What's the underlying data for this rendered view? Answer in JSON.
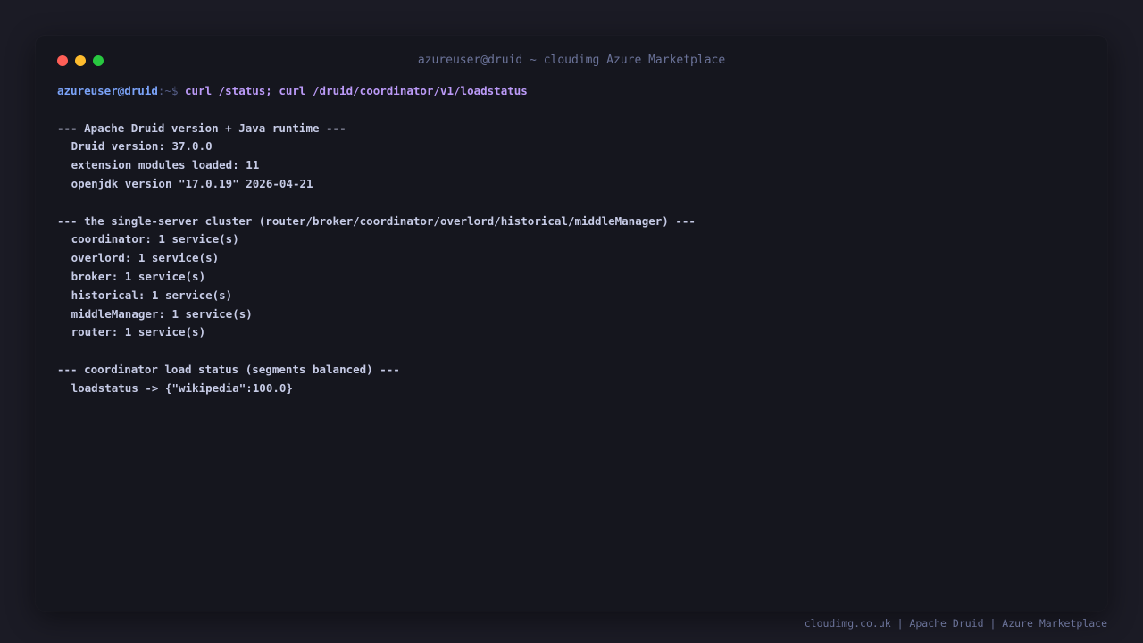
{
  "window": {
    "title": "azureuser@druid ~ cloudimg Azure Marketplace",
    "controls": {
      "close_color": "#ff5f57",
      "minimize_color": "#febc2e",
      "maximize_color": "#28c840"
    }
  },
  "prompt": {
    "user_host": "azureuser@druid",
    "separator": ":~$ ",
    "command": "curl /status; curl /druid/coordinator/v1/loadstatus"
  },
  "sections": {
    "version": {
      "header": "--- Apache Druid version + Java runtime ---",
      "lines": [
        "Druid version: 37.0.0",
        "extension modules loaded: 11",
        "openjdk version \"17.0.19\" 2026-04-21"
      ]
    },
    "cluster": {
      "header": "--- the single-server cluster (router/broker/coordinator/overlord/historical/middleManager) ---",
      "lines": [
        "coordinator: 1 service(s)",
        "overlord: 1 service(s)",
        "broker: 1 service(s)",
        "historical: 1 service(s)",
        "middleManager: 1 service(s)",
        "router: 1 service(s)"
      ]
    },
    "loadstatus": {
      "header": "--- coordinator load status (segments balanced) ---",
      "lines": [
        "loadstatus -> {\"wikipedia\":100.0}"
      ]
    }
  },
  "footer": {
    "text": "cloudimg.co.uk | Apache Druid | Azure Marketplace"
  },
  "colors": {
    "background": "#1b1b25",
    "terminal_bg": "#15161e",
    "text": "#c6cbe6",
    "prompt_user": "#7aa2f7",
    "prompt_command": "#bb9af7",
    "muted": "#6b7399"
  }
}
